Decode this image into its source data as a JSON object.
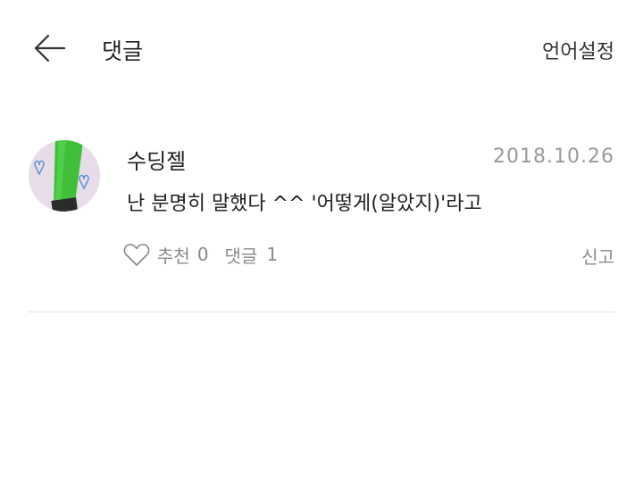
{
  "header": {
    "back_icon": "arrow-left-icon",
    "title": "댓글",
    "language_label": "언어설정"
  },
  "comment": {
    "avatar_icon": "avatar-image",
    "username": "수딩젤",
    "date": "2018.10.26",
    "text": "난 분명히 말했다 ^^ '어떻게(알았지)'라고",
    "like_icon": "heart-outline-icon",
    "like_label": "추천",
    "like_count": "0",
    "reply_label": "댓글",
    "reply_count": "1",
    "report_label": "신고"
  },
  "colors": {
    "text": "#222222",
    "muted": "#8a8a8a",
    "date": "#9a9a9a",
    "divider": "#e0e0e0"
  }
}
